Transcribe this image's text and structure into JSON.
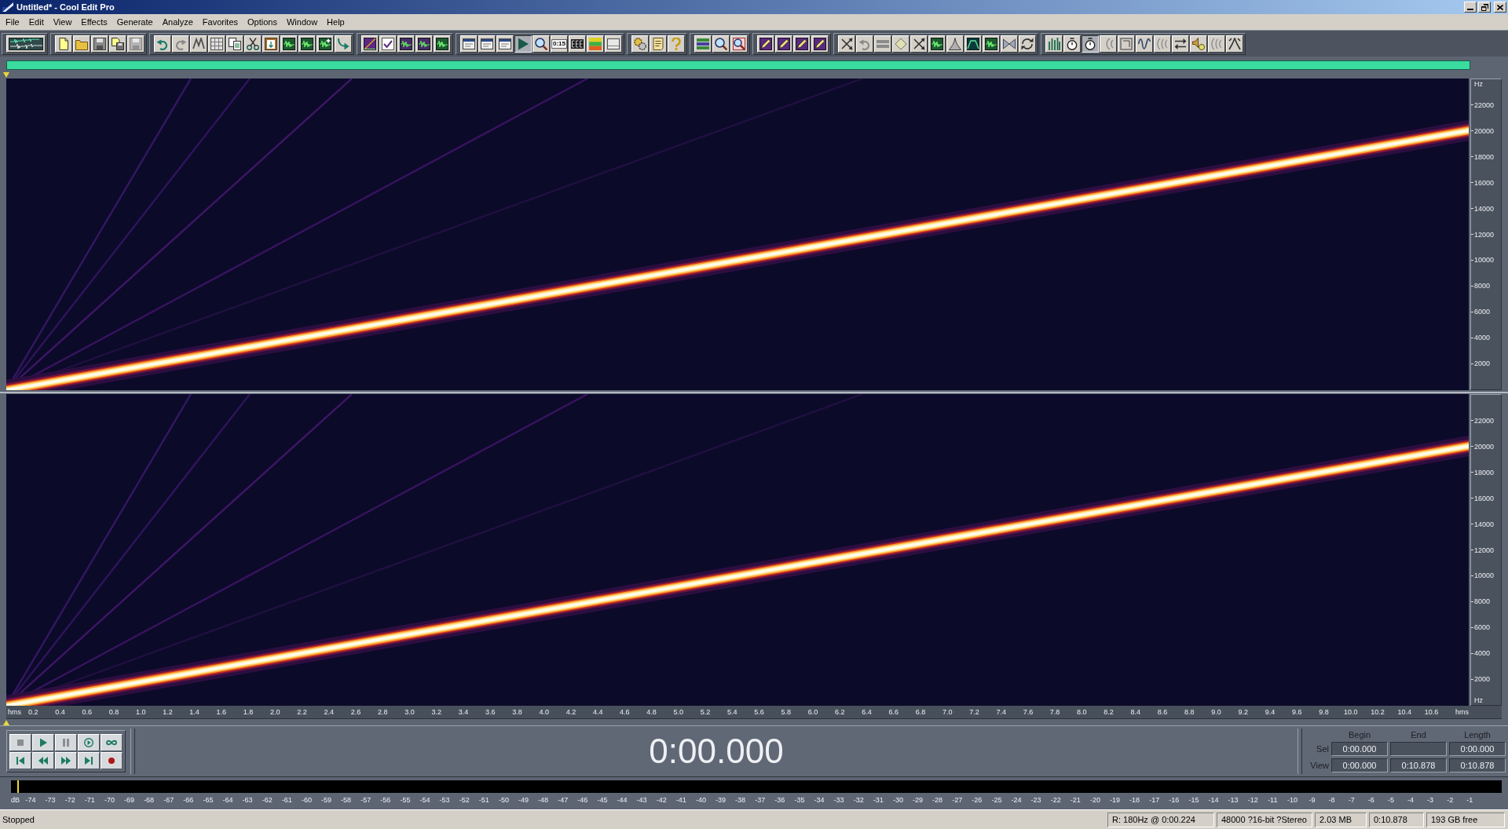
{
  "window": {
    "title": "Untitled* - Cool Edit Pro"
  },
  "menu": [
    "File",
    "Edit",
    "View",
    "Effects",
    "Generate",
    "Analyze",
    "Favorites",
    "Options",
    "Window",
    "Help"
  ],
  "toolbar": [
    {
      "buttons": [
        {
          "pressed": false
        }
      ]
    },
    {
      "buttons": [
        {
          "pressed": false
        },
        {
          "pressed": false
        },
        {
          "pressed": false
        },
        {
          "pressed": false
        },
        {
          "pressed": false
        }
      ]
    },
    {
      "buttons": [
        {
          "pressed": false
        },
        {
          "pressed": false
        },
        {
          "pressed": false
        },
        {
          "pressed": false
        },
        {
          "pressed": false
        },
        {
          "pressed": false
        },
        {
          "pressed": false
        },
        {
          "pressed": false
        },
        {
          "pressed": false
        },
        {
          "pressed": false
        },
        {
          "pressed": false
        }
      ]
    },
    {
      "buttons": [
        {
          "pressed": false
        },
        {
          "pressed": false
        },
        {
          "pressed": false
        },
        {
          "pressed": false
        },
        {
          "pressed": false
        }
      ]
    },
    {
      "buttons": [
        {
          "pressed": false
        },
        {
          "pressed": false
        },
        {
          "pressed": false
        },
        {
          "pressed": true
        },
        {
          "pressed": false
        },
        {
          "pressed": false,
          "label": "0:15"
        },
        {
          "pressed": false
        },
        {
          "pressed": false
        },
        {
          "pressed": false
        }
      ]
    },
    {
      "buttons": [
        {
          "pressed": false
        },
        {
          "pressed": false
        },
        {
          "pressed": false
        }
      ]
    },
    {
      "buttons": [
        {
          "pressed": false
        },
        {
          "pressed": false
        },
        {
          "pressed": false
        }
      ]
    },
    {
      "buttons": [
        {
          "pressed": false
        },
        {
          "pressed": false
        },
        {
          "pressed": false
        },
        {
          "pressed": false
        }
      ]
    },
    {
      "buttons": [
        {
          "pressed": false
        },
        {
          "pressed": false
        },
        {
          "pressed": false
        },
        {
          "pressed": false
        },
        {
          "pressed": false
        },
        {
          "pressed": false
        },
        {
          "pressed": false
        },
        {
          "pressed": false
        },
        {
          "pressed": false
        },
        {
          "pressed": false
        },
        {
          "pressed": false
        }
      ]
    },
    {
      "buttons": [
        {
          "pressed": false
        },
        {
          "pressed": false
        },
        {
          "pressed": true
        },
        {
          "pressed": false
        },
        {
          "pressed": false
        },
        {
          "pressed": false
        },
        {
          "pressed": false
        },
        {
          "pressed": false
        },
        {
          "pressed": false
        },
        {
          "pressed": false
        },
        {
          "pressed": false
        }
      ]
    }
  ],
  "channels": [
    {
      "unit_top": "Hz",
      "ruler_labels": [
        "22000",
        "20000",
        "18000",
        "16000",
        "14000",
        "12000",
        "10000",
        "8000",
        "6000",
        "4000",
        "2000"
      ]
    },
    {
      "ruler_labels": [
        "22000",
        "20000",
        "18000",
        "16000",
        "14000",
        "12000",
        "10000",
        "8000",
        "6000",
        "4000",
        "2000"
      ],
      "unit_bottom": "Hz"
    }
  ],
  "time_axis": {
    "unit_left": "hms",
    "labels": [
      "0.2",
      "0.4",
      "0.6",
      "0.8",
      "1.0",
      "1.2",
      "1.4",
      "1.6",
      "1.8",
      "2.0",
      "2.2",
      "2.4",
      "2.6",
      "2.8",
      "3.0",
      "3.2",
      "3.4",
      "3.6",
      "3.8",
      "4.0",
      "4.2",
      "4.4",
      "4.6",
      "4.8",
      "5.0",
      "5.2",
      "5.4",
      "5.6",
      "5.8",
      "6.0",
      "6.2",
      "6.4",
      "6.6",
      "6.8",
      "7.0",
      "7.2",
      "7.4",
      "7.6",
      "7.8",
      "8.0",
      "8.2",
      "8.4",
      "8.6",
      "8.8",
      "9.0",
      "9.2",
      "9.4",
      "9.6",
      "9.8",
      "10.0",
      "10.2",
      "10.4",
      "10.6"
    ],
    "unit_right": "hms"
  },
  "time_display": "0:00.000",
  "selection": {
    "headers": [
      "Begin",
      "End",
      "Length"
    ],
    "rows": [
      {
        "label": "Sel",
        "begin": "0:00.000",
        "length": "0:00.000"
      },
      {
        "label": "View",
        "begin": "0:00.000",
        "end": "0:10.878",
        "length": "0:10.878"
      }
    ]
  },
  "level_meter": {
    "unit": "dB",
    "labels": [
      "-74",
      "-73",
      "-72",
      "-71",
      "-70",
      "-69",
      "-68",
      "-67",
      "-66",
      "-65",
      "-64",
      "-63",
      "-62",
      "-61",
      "-60",
      "-59",
      "-58",
      "-57",
      "-56",
      "-55",
      "-54",
      "-53",
      "-52",
      "-51",
      "-50",
      "-49",
      "-48",
      "-47",
      "-46",
      "-45",
      "-44",
      "-43",
      "-42",
      "-41",
      "-40",
      "-39",
      "-38",
      "-37",
      "-36",
      "-35",
      "-34",
      "-33",
      "-32",
      "-31",
      "-30",
      "-29",
      "-28",
      "-27",
      "-26",
      "-25",
      "-24",
      "-23",
      "-22",
      "-21",
      "-20",
      "-19",
      "-18",
      "-17",
      "-16",
      "-15",
      "-14",
      "-13",
      "-12",
      "-11",
      "-10",
      "-9",
      "-8",
      "-7",
      "-6",
      "-5",
      "-4",
      "-3",
      "-2",
      "-1"
    ]
  },
  "status_bar": {
    "state": "Stopped",
    "fields": [
      "R: 180Hz @ 0:00.224",
      "48000 ?16-bit ?Stereo",
      "2.03 MB",
      "0:10.878",
      "193 GB free"
    ]
  }
}
